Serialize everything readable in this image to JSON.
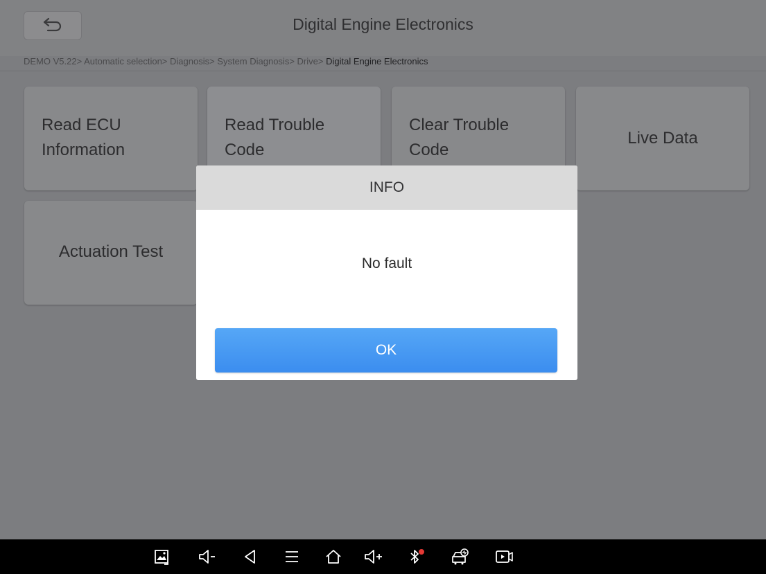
{
  "header": {
    "title": "Digital Engine Electronics"
  },
  "breadcrumb": {
    "path": "DEMO V5.22> Automatic selection> Diagnosis> System Diagnosis> Drive> ",
    "current": "Digital Engine Electronics"
  },
  "functions": [
    {
      "label": "Read ECU Information"
    },
    {
      "label": "Read Trouble Code"
    },
    {
      "label": "Clear Trouble Code"
    },
    {
      "label": "Live Data"
    },
    {
      "label": "Actuation Test"
    }
  ],
  "dialog": {
    "title": "INFO",
    "message": "No fault",
    "ok_label": "OK"
  },
  "navbar": {
    "icons": [
      "screenshot-icon",
      "volume-down-icon",
      "back-icon",
      "menu-icon",
      "home-icon",
      "volume-up-icon",
      "bluetooth-icon",
      "vehicle-diagnostic-icon",
      "screen-record-icon"
    ],
    "bluetooth_badge_color": "#e53935"
  },
  "colors": {
    "ok_button": "#4a9bf2",
    "overlay_background": "#7c7d80"
  }
}
